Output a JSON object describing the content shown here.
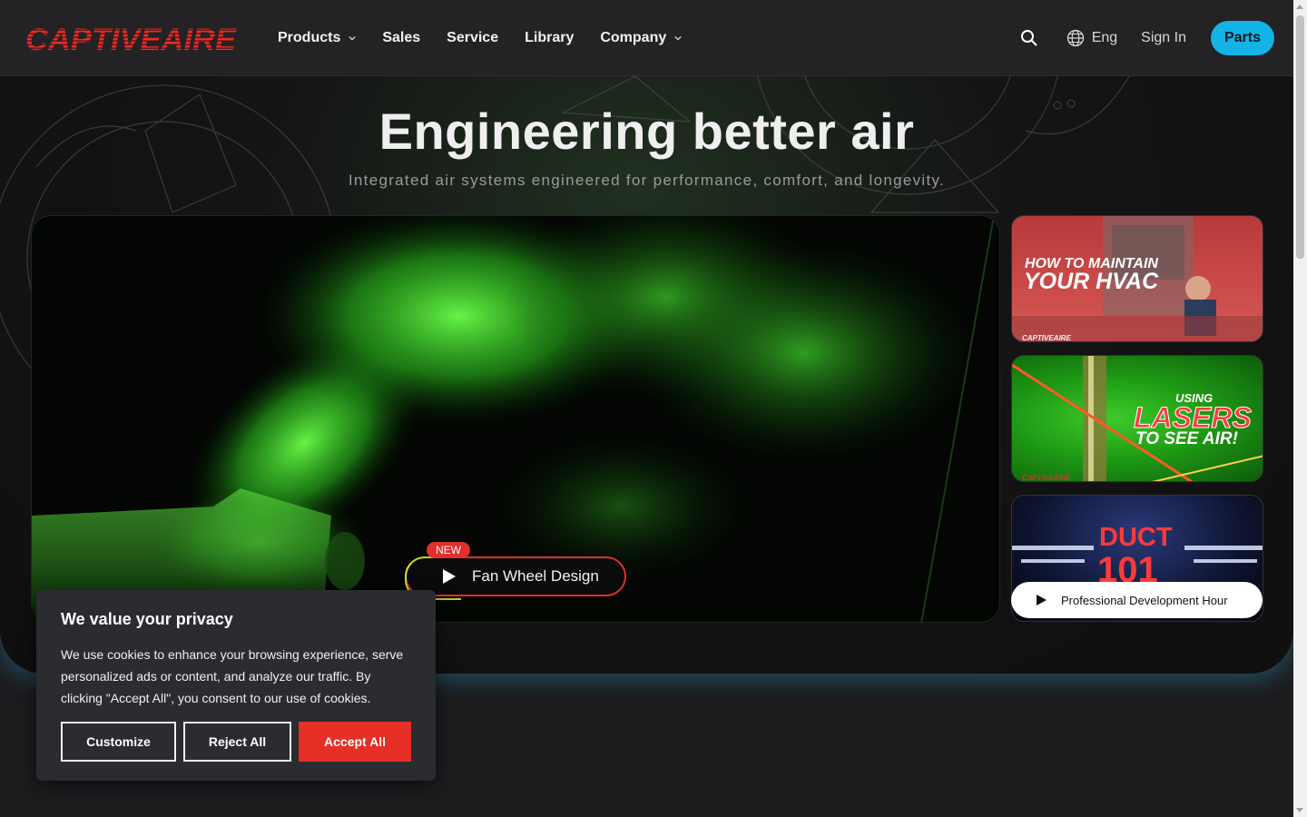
{
  "brand": {
    "logo_text": "CAPTIVEAIRE",
    "accent": "#e52f27",
    "parts_color": "#13b3e6"
  },
  "nav": {
    "items": [
      {
        "label": "Products",
        "has_dropdown": true
      },
      {
        "label": "Sales",
        "has_dropdown": false
      },
      {
        "label": "Service",
        "has_dropdown": false
      },
      {
        "label": "Library",
        "has_dropdown": false
      },
      {
        "label": "Company",
        "has_dropdown": true
      }
    ],
    "language": "Eng",
    "signin": "Sign In",
    "parts": "Parts"
  },
  "hero": {
    "title": "Engineering better air",
    "subtitle": "Integrated air systems engineered for performance, comfort, and longevity.",
    "feature": {
      "badge": "NEW",
      "label": "Fan Wheel Design"
    }
  },
  "thumbnails": [
    {
      "line1": "HOW TO MAINTAIN",
      "line2": "YOUR HVAC",
      "brand": "CAPTIVEAIRE"
    },
    {
      "line1": "USING",
      "line2": "LASERS",
      "line3": "TO SEE AIR!",
      "brand": "CAPTIVEAIRE"
    },
    {
      "line1": "DUCT",
      "line2": "101",
      "button": "Professional Development Hour"
    }
  ],
  "cookie": {
    "title": "We value your privacy",
    "body": "We use cookies to enhance your browsing experience, serve personalized ads or content, and analyze our traffic. By clicking \"Accept All\", you consent to our use of cookies.",
    "customize": "Customize",
    "reject": "Reject All",
    "accept": "Accept All"
  }
}
